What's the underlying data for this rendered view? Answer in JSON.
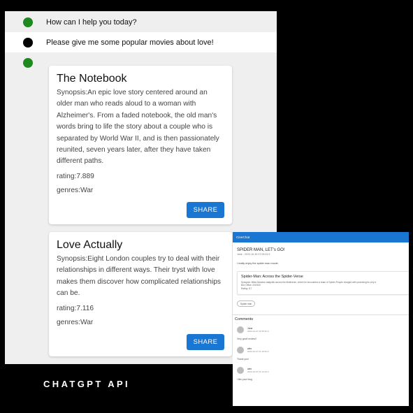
{
  "colors": {
    "bot_dot": "#1e8a1e",
    "user_dot": "#000000",
    "share_button": "#1976d2",
    "inset_header": "#1976d2"
  },
  "chat": {
    "messages": [
      {
        "role": "bot",
        "text": "How can I help you today?"
      },
      {
        "role": "user",
        "text": "Please give me some popular movies about love!"
      },
      {
        "role": "bot",
        "text": ""
      }
    ],
    "movies": [
      {
        "title": "The Notebook",
        "synopsis": "Synopsis:An epic love story centered around an older man who reads aloud to a woman with Alzheimer's. From a faded notebook, the old man's words bring to life the story about a couple who is separated by World War II, and is then passionately reunited, seven years later, after they have taken different paths.",
        "rating": "rating:7.889",
        "genres": "genres:War",
        "share_label": "SHARE"
      },
      {
        "title": "Love Actually",
        "synopsis": "Synopsis:Eight London couples try to deal with their relationships in different ways. Their tryst with love makes them discover how complicated relationships can be.",
        "rating": "rating:7.116",
        "genres": "genres:War",
        "share_label": "SHARE"
      }
    ]
  },
  "caption": "CHATGPT API",
  "inset": {
    "app_title": "CineChat",
    "post": {
      "title": "SPIDER MAN, LET's GO!",
      "meta": "Jane - 2023-10-30 07:09:24.5",
      "body": "I really enjoy the spider man movie."
    },
    "movie_card": {
      "title": "Spider-Man: Across the Spider-Verse",
      "synopsis": "Synopsis: Miles Morales catapults across the Multiverse, where he encounters a team of Spider-People charged with protecting its very e",
      "box_office": "Box Office: 200/100",
      "rating": "Rating: 8.7"
    },
    "tag": "Spider man",
    "comments_title": "Comments",
    "comments": [
      {
        "user": "Jane",
        "date": "2023-10-07 22:25:30.0",
        "text": "Very good review!!"
      },
      {
        "user": "alex",
        "date": "2023-10-07 21:15:30.0",
        "text": "Thank you!"
      },
      {
        "user": "alex",
        "date": "2023-10-07 21:14:10.0",
        "text": "I like your blog"
      }
    ]
  }
}
